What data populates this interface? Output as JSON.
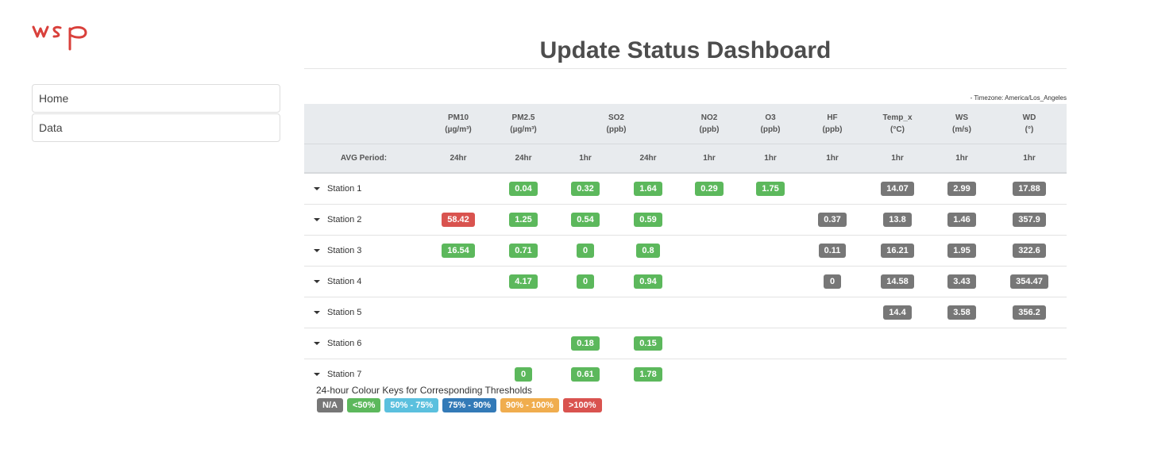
{
  "logo": {
    "text": "wsp",
    "color": "#d9403b"
  },
  "nav": {
    "items": [
      "Home",
      "Data"
    ]
  },
  "page_title": "Update Status Dashboard",
  "timezone_label": "- Timezone: America/Los_Angeles",
  "colors": {
    "na": "#777777",
    "green": "#5cb85c",
    "light_blue": "#5bc0de",
    "dark_blue": "#337ab7",
    "orange": "#f0ad4e",
    "red": "#d9534f",
    "header_bg": "#e8ebee"
  },
  "table": {
    "header_groups": [
      {
        "name": "",
        "unit": ""
      },
      {
        "name": "PM10",
        "unit": "(µg/m³)"
      },
      {
        "name": "PM2.5",
        "unit": "(µg/m³)"
      },
      {
        "name": "SO2",
        "unit": "(ppb)"
      },
      {
        "name": "NO2",
        "unit": "(ppb)"
      },
      {
        "name": "O3",
        "unit": "(ppb)"
      },
      {
        "name": "HF",
        "unit": "(ppb)"
      },
      {
        "name": "Temp_x",
        "unit": "(°C)"
      },
      {
        "name": "WS",
        "unit": "(m/s)"
      },
      {
        "name": "WD",
        "unit": "(°)"
      }
    ],
    "avg_label": "AVG Period:",
    "periods": [
      "24hr",
      "24hr",
      "1hr",
      "24hr",
      "1hr",
      "1hr",
      "1hr",
      "1hr",
      "1hr",
      "1hr"
    ],
    "rows": [
      {
        "station": "Station 1",
        "cells": [
          null,
          {
            "v": "0.04",
            "c": "green"
          },
          {
            "v": "0.32",
            "c": "green"
          },
          {
            "v": "1.64",
            "c": "green"
          },
          {
            "v": "0.29",
            "c": "green"
          },
          {
            "v": "1.75",
            "c": "green"
          },
          null,
          {
            "v": "14.07",
            "c": "na"
          },
          {
            "v": "2.99",
            "c": "na"
          },
          {
            "v": "17.88",
            "c": "na"
          }
        ]
      },
      {
        "station": "Station 2",
        "cells": [
          {
            "v": "58.42",
            "c": "red"
          },
          {
            "v": "1.25",
            "c": "green"
          },
          {
            "v": "0.54",
            "c": "green"
          },
          {
            "v": "0.59",
            "c": "green"
          },
          null,
          null,
          {
            "v": "0.37",
            "c": "na"
          },
          {
            "v": "13.8",
            "c": "na"
          },
          {
            "v": "1.46",
            "c": "na"
          },
          {
            "v": "357.9",
            "c": "na"
          }
        ]
      },
      {
        "station": "Station 3",
        "cells": [
          {
            "v": "16.54",
            "c": "green"
          },
          {
            "v": "0.71",
            "c": "green"
          },
          {
            "v": "0",
            "c": "green"
          },
          {
            "v": "0.8",
            "c": "green"
          },
          null,
          null,
          {
            "v": "0.11",
            "c": "na"
          },
          {
            "v": "16.21",
            "c": "na"
          },
          {
            "v": "1.95",
            "c": "na"
          },
          {
            "v": "322.6",
            "c": "na"
          }
        ]
      },
      {
        "station": "Station 4",
        "cells": [
          null,
          {
            "v": "4.17",
            "c": "green"
          },
          {
            "v": "0",
            "c": "green"
          },
          {
            "v": "0.94",
            "c": "green"
          },
          null,
          null,
          {
            "v": "0",
            "c": "na"
          },
          {
            "v": "14.58",
            "c": "na"
          },
          {
            "v": "3.43",
            "c": "na"
          },
          {
            "v": "354.47",
            "c": "na"
          }
        ]
      },
      {
        "station": "Station 5",
        "cells": [
          null,
          null,
          null,
          null,
          null,
          null,
          null,
          {
            "v": "14.4",
            "c": "na"
          },
          {
            "v": "3.58",
            "c": "na"
          },
          {
            "v": "356.2",
            "c": "na"
          }
        ]
      },
      {
        "station": "Station 6",
        "cells": [
          null,
          null,
          {
            "v": "0.18",
            "c": "green"
          },
          {
            "v": "0.15",
            "c": "green"
          },
          null,
          null,
          null,
          null,
          null,
          null
        ]
      },
      {
        "station": "Station 7",
        "cells": [
          null,
          {
            "v": "0",
            "c": "green"
          },
          {
            "v": "0.61",
            "c": "green"
          },
          {
            "v": "1.78",
            "c": "green"
          },
          null,
          null,
          null,
          null,
          null,
          null
        ]
      }
    ]
  },
  "legend": {
    "title": "24-hour Colour Keys for Corresponding Thresholds",
    "items": [
      {
        "label": "N/A",
        "c": "na"
      },
      {
        "label": "<50%",
        "c": "green"
      },
      {
        "label": "50% - 75%",
        "c": "light_blue"
      },
      {
        "label": "75% - 90%",
        "c": "dark_blue"
      },
      {
        "label": "90% - 100%",
        "c": "orange"
      },
      {
        "label": ">100%",
        "c": "red"
      }
    ]
  }
}
